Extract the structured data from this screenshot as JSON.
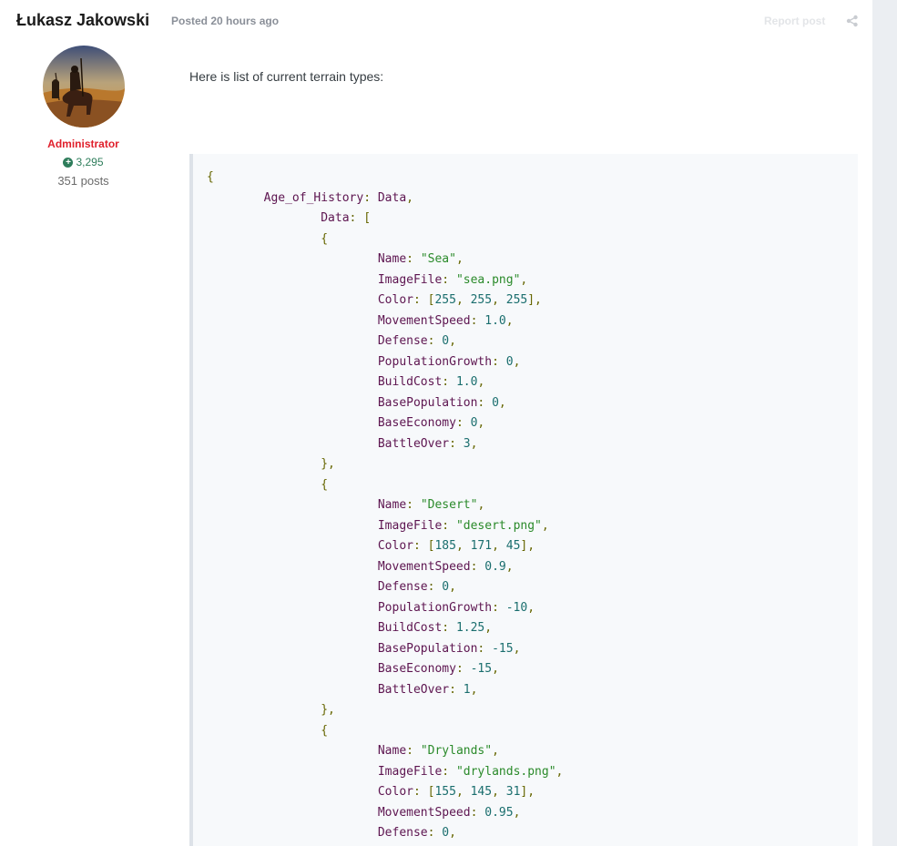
{
  "author": {
    "name": "Łukasz Jakowski",
    "role": "Administrator",
    "reputation": "3,295",
    "posts": "351 posts"
  },
  "post": {
    "meta": "Posted 20 hours ago",
    "report_label": "Report post",
    "intro": "Here is list of current terrain types:"
  },
  "code_lines": [
    [
      {
        "t": "{",
        "c": "punc"
      }
    ],
    [
      {
        "t": "        ",
        "c": "plain"
      },
      {
        "t": "Age_of_History",
        "c": "key"
      },
      {
        "t": ": ",
        "c": "punc"
      },
      {
        "t": "Data",
        "c": "key"
      },
      {
        "t": ",",
        "c": "punc"
      }
    ],
    [
      {
        "t": "                ",
        "c": "plain"
      },
      {
        "t": "Data",
        "c": "key"
      },
      {
        "t": ": [",
        "c": "punc"
      }
    ],
    [
      {
        "t": "                {",
        "c": "punc"
      }
    ],
    [
      {
        "t": "                        ",
        "c": "plain"
      },
      {
        "t": "Name",
        "c": "key"
      },
      {
        "t": ": ",
        "c": "punc"
      },
      {
        "t": "\"Sea\"",
        "c": "str"
      },
      {
        "t": ",",
        "c": "punc"
      }
    ],
    [
      {
        "t": "                        ",
        "c": "plain"
      },
      {
        "t": "ImageFile",
        "c": "key"
      },
      {
        "t": ": ",
        "c": "punc"
      },
      {
        "t": "\"sea.png\"",
        "c": "str"
      },
      {
        "t": ",",
        "c": "punc"
      }
    ],
    [
      {
        "t": "                        ",
        "c": "plain"
      },
      {
        "t": "Color",
        "c": "key"
      },
      {
        "t": ": [",
        "c": "punc"
      },
      {
        "t": "255",
        "c": "num"
      },
      {
        "t": ", ",
        "c": "punc"
      },
      {
        "t": "255",
        "c": "num"
      },
      {
        "t": ", ",
        "c": "punc"
      },
      {
        "t": "255",
        "c": "num"
      },
      {
        "t": "],",
        "c": "punc"
      }
    ],
    [
      {
        "t": "                        ",
        "c": "plain"
      },
      {
        "t": "MovementSpeed",
        "c": "key"
      },
      {
        "t": ": ",
        "c": "punc"
      },
      {
        "t": "1.0",
        "c": "num"
      },
      {
        "t": ",",
        "c": "punc"
      }
    ],
    [
      {
        "t": "                        ",
        "c": "plain"
      },
      {
        "t": "Defense",
        "c": "key"
      },
      {
        "t": ": ",
        "c": "punc"
      },
      {
        "t": "0",
        "c": "num"
      },
      {
        "t": ",",
        "c": "punc"
      }
    ],
    [
      {
        "t": "                        ",
        "c": "plain"
      },
      {
        "t": "PopulationGrowth",
        "c": "key"
      },
      {
        "t": ": ",
        "c": "punc"
      },
      {
        "t": "0",
        "c": "num"
      },
      {
        "t": ",",
        "c": "punc"
      }
    ],
    [
      {
        "t": "                        ",
        "c": "plain"
      },
      {
        "t": "BuildCost",
        "c": "key"
      },
      {
        "t": ": ",
        "c": "punc"
      },
      {
        "t": "1.0",
        "c": "num"
      },
      {
        "t": ",",
        "c": "punc"
      }
    ],
    [
      {
        "t": "                        ",
        "c": "plain"
      },
      {
        "t": "BasePopulation",
        "c": "key"
      },
      {
        "t": ": ",
        "c": "punc"
      },
      {
        "t": "0",
        "c": "num"
      },
      {
        "t": ",",
        "c": "punc"
      }
    ],
    [
      {
        "t": "                        ",
        "c": "plain"
      },
      {
        "t": "BaseEconomy",
        "c": "key"
      },
      {
        "t": ": ",
        "c": "punc"
      },
      {
        "t": "0",
        "c": "num"
      },
      {
        "t": ",",
        "c": "punc"
      }
    ],
    [
      {
        "t": "                        ",
        "c": "plain"
      },
      {
        "t": "BattleOver",
        "c": "key"
      },
      {
        "t": ": ",
        "c": "punc"
      },
      {
        "t": "3",
        "c": "num"
      },
      {
        "t": ",",
        "c": "punc"
      }
    ],
    [
      {
        "t": "                },",
        "c": "punc"
      }
    ],
    [
      {
        "t": "                {",
        "c": "punc"
      }
    ],
    [
      {
        "t": "                        ",
        "c": "plain"
      },
      {
        "t": "Name",
        "c": "key"
      },
      {
        "t": ": ",
        "c": "punc"
      },
      {
        "t": "\"Desert\"",
        "c": "str"
      },
      {
        "t": ",",
        "c": "punc"
      }
    ],
    [
      {
        "t": "                        ",
        "c": "plain"
      },
      {
        "t": "ImageFile",
        "c": "key"
      },
      {
        "t": ": ",
        "c": "punc"
      },
      {
        "t": "\"desert.png\"",
        "c": "str"
      },
      {
        "t": ",",
        "c": "punc"
      }
    ],
    [
      {
        "t": "                        ",
        "c": "plain"
      },
      {
        "t": "Color",
        "c": "key"
      },
      {
        "t": ": [",
        "c": "punc"
      },
      {
        "t": "185",
        "c": "num"
      },
      {
        "t": ", ",
        "c": "punc"
      },
      {
        "t": "171",
        "c": "num"
      },
      {
        "t": ", ",
        "c": "punc"
      },
      {
        "t": "45",
        "c": "num"
      },
      {
        "t": "],",
        "c": "punc"
      }
    ],
    [
      {
        "t": "                        ",
        "c": "plain"
      },
      {
        "t": "MovementSpeed",
        "c": "key"
      },
      {
        "t": ": ",
        "c": "punc"
      },
      {
        "t": "0.9",
        "c": "num"
      },
      {
        "t": ",",
        "c": "punc"
      }
    ],
    [
      {
        "t": "                        ",
        "c": "plain"
      },
      {
        "t": "Defense",
        "c": "key"
      },
      {
        "t": ": ",
        "c": "punc"
      },
      {
        "t": "0",
        "c": "num"
      },
      {
        "t": ",",
        "c": "punc"
      }
    ],
    [
      {
        "t": "                        ",
        "c": "plain"
      },
      {
        "t": "PopulationGrowth",
        "c": "key"
      },
      {
        "t": ": ",
        "c": "punc"
      },
      {
        "t": "-10",
        "c": "num"
      },
      {
        "t": ",",
        "c": "punc"
      }
    ],
    [
      {
        "t": "                        ",
        "c": "plain"
      },
      {
        "t": "BuildCost",
        "c": "key"
      },
      {
        "t": ": ",
        "c": "punc"
      },
      {
        "t": "1.25",
        "c": "num"
      },
      {
        "t": ",",
        "c": "punc"
      }
    ],
    [
      {
        "t": "                        ",
        "c": "plain"
      },
      {
        "t": "BasePopulation",
        "c": "key"
      },
      {
        "t": ": ",
        "c": "punc"
      },
      {
        "t": "-15",
        "c": "num"
      },
      {
        "t": ",",
        "c": "punc"
      }
    ],
    [
      {
        "t": "                        ",
        "c": "plain"
      },
      {
        "t": "BaseEconomy",
        "c": "key"
      },
      {
        "t": ": ",
        "c": "punc"
      },
      {
        "t": "-15",
        "c": "num"
      },
      {
        "t": ",",
        "c": "punc"
      }
    ],
    [
      {
        "t": "                        ",
        "c": "plain"
      },
      {
        "t": "BattleOver",
        "c": "key"
      },
      {
        "t": ": ",
        "c": "punc"
      },
      {
        "t": "1",
        "c": "num"
      },
      {
        "t": ",",
        "c": "punc"
      }
    ],
    [
      {
        "t": "                },",
        "c": "punc"
      }
    ],
    [
      {
        "t": "                {",
        "c": "punc"
      }
    ],
    [
      {
        "t": "                        ",
        "c": "plain"
      },
      {
        "t": "Name",
        "c": "key"
      },
      {
        "t": ": ",
        "c": "punc"
      },
      {
        "t": "\"Drylands\"",
        "c": "str"
      },
      {
        "t": ",",
        "c": "punc"
      }
    ],
    [
      {
        "t": "                        ",
        "c": "plain"
      },
      {
        "t": "ImageFile",
        "c": "key"
      },
      {
        "t": ": ",
        "c": "punc"
      },
      {
        "t": "\"drylands.png\"",
        "c": "str"
      },
      {
        "t": ",",
        "c": "punc"
      }
    ],
    [
      {
        "t": "                        ",
        "c": "plain"
      },
      {
        "t": "Color",
        "c": "key"
      },
      {
        "t": ": [",
        "c": "punc"
      },
      {
        "t": "155",
        "c": "num"
      },
      {
        "t": ", ",
        "c": "punc"
      },
      {
        "t": "145",
        "c": "num"
      },
      {
        "t": ", ",
        "c": "punc"
      },
      {
        "t": "31",
        "c": "num"
      },
      {
        "t": "],",
        "c": "punc"
      }
    ],
    [
      {
        "t": "                        ",
        "c": "plain"
      },
      {
        "t": "MovementSpeed",
        "c": "key"
      },
      {
        "t": ": ",
        "c": "punc"
      },
      {
        "t": "0.95",
        "c": "num"
      },
      {
        "t": ",",
        "c": "punc"
      }
    ],
    [
      {
        "t": "                        ",
        "c": "plain"
      },
      {
        "t": "Defense",
        "c": "key"
      },
      {
        "t": ": ",
        "c": "punc"
      },
      {
        "t": "0",
        "c": "num"
      },
      {
        "t": ",",
        "c": "punc"
      }
    ]
  ],
  "colors": {
    "role": "#e0202c",
    "reputation": "#2e7d5b",
    "code_background": "#f7f9fb",
    "code_key": "#5d1550",
    "code_string": "#2a8a2a",
    "code_number": "#1a6e6e",
    "code_punctuation": "#666600"
  },
  "icons": {
    "reputation": "plus-circle-icon",
    "share": "share-icon"
  }
}
